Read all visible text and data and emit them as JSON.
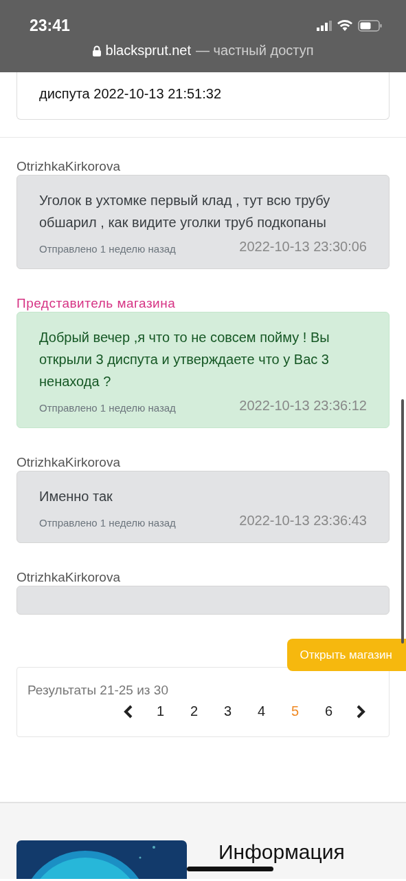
{
  "status_bar": {
    "time": "23:41"
  },
  "address_bar": {
    "domain": "blacksprut.net",
    "suffix": "— частный доступ"
  },
  "top_card": {
    "text": "диспута 2022-10-13 21:51:32"
  },
  "messages": [
    {
      "author": "OtrizhkaKirkorova",
      "kind": "buyer",
      "text": "Уголок в ухтомке первый клад , тут всю трубу обшарил , как видите уголки труб подкопаны",
      "sent": "Отправлено 1 неделю назад",
      "timestamp": "2022-10-13 23:30:06"
    },
    {
      "author": "Представитель магазина",
      "kind": "seller",
      "text": "Добрый вечер ,я что то не совсем пойму ! Вы открыли 3 диспута и утверждаете что у Вас 3 ненахода ?",
      "sent": "Отправлено 1 неделю назад",
      "timestamp": "2022-10-13 23:36:12"
    },
    {
      "author": "OtrizhkaKirkorova",
      "kind": "buyer",
      "text": "Именно так",
      "sent": "Отправлено 1 неделю назад",
      "timestamp": "2022-10-13 23:36:43"
    },
    {
      "author": "OtrizhkaKirkorova",
      "kind": "buyer"
    }
  ],
  "open_shop_button": "Открыть магазин",
  "pagination": {
    "summary": "Результаты 21-25 из 30",
    "pages": [
      {
        "label": "1",
        "selected": false
      },
      {
        "label": "2",
        "selected": false
      },
      {
        "label": "3",
        "selected": false
      },
      {
        "label": "4",
        "selected": false
      },
      {
        "label": "5",
        "selected": true
      },
      {
        "label": "6",
        "selected": false
      }
    ]
  },
  "footer": {
    "heading": "Информация"
  }
}
